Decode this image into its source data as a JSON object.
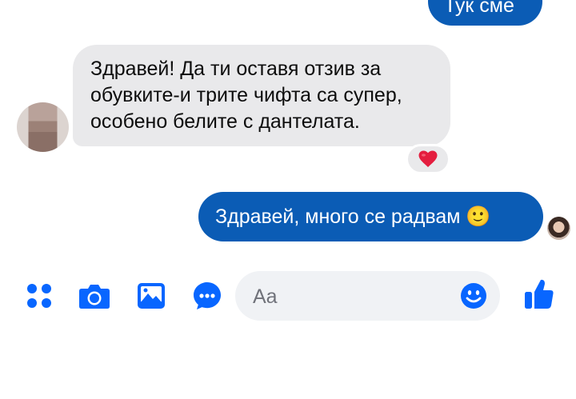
{
  "conversation": {
    "top_outgoing": "Тук сме",
    "incoming_lines": [
      "Здравей! Да ти оставя отзив за",
      "обувките-и трите чифта са супер,",
      "особено белите с дантелата."
    ],
    "reaction": "heart",
    "reply": "Здравей, много се радвам 🙂"
  },
  "composer": {
    "placeholder": "Aa",
    "value": ""
  },
  "toolbar": {
    "icons": [
      "more-apps-icon",
      "camera-icon",
      "gallery-icon",
      "sticker-chat-icon",
      "emoji-icon",
      "thumbs-up-icon"
    ]
  },
  "colors": {
    "accent": "#0866ff",
    "outgoing_bubble": "#0b5cb5",
    "incoming_bubble": "#e9e9eb",
    "reaction_heart": "#e41e3f",
    "composer_bg": "#f0f2f5"
  }
}
